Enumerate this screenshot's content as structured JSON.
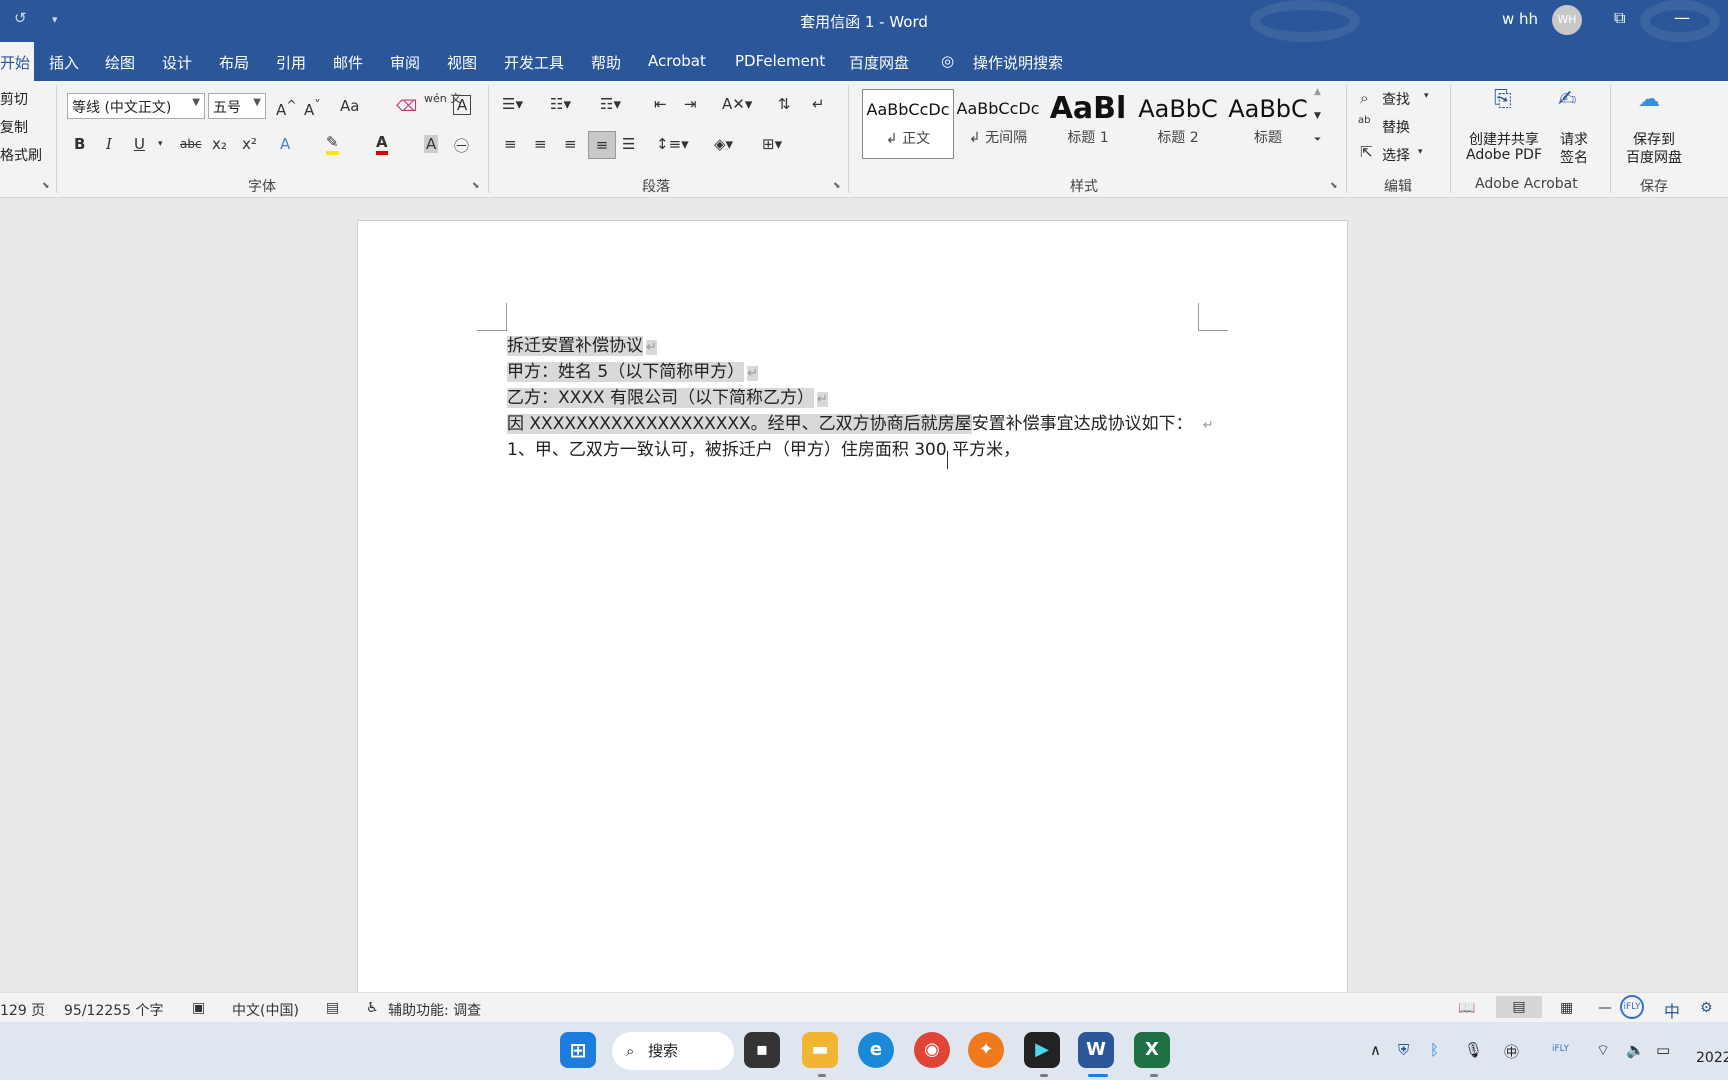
{
  "window": {
    "title": "套用信函 1  -  Word",
    "user_name": "w hh",
    "user_initials": "WH",
    "accent_color": "#2b579a"
  },
  "menu": {
    "tabs": [
      "开始",
      "插入",
      "绘图",
      "设计",
      "布局",
      "引用",
      "邮件",
      "审阅",
      "视图",
      "开发工具",
      "帮助",
      "Acrobat",
      "PDFelement",
      "百度网盘"
    ],
    "active_tab": "开始",
    "tell_me": "操作说明搜索"
  },
  "ribbon": {
    "clipboard": {
      "cut": "剪切",
      "copy": "复制",
      "format_painter": "格式刷"
    },
    "font": {
      "font_name": "等线 (中文正文)",
      "font_size": "五号",
      "group_label": "字体",
      "bold": "B",
      "italic": "I",
      "underline": "U",
      "strike": "abc",
      "sub": "x₂",
      "sup": "x²",
      "grow": "A^",
      "shrink": "A˅",
      "case": "Aa",
      "pinyin": "wén 文",
      "char_border": "A"
    },
    "paragraph": {
      "group_label": "段落"
    },
    "styles": {
      "group_label": "样式",
      "items": [
        {
          "sample": "AaBbCcDc",
          "name": "↲ 正文"
        },
        {
          "sample": "AaBbCcDc",
          "name": "↲ 无间隔"
        },
        {
          "sample": "AaBl",
          "name": "标题 1"
        },
        {
          "sample": "AaBbC",
          "name": "标题 2"
        },
        {
          "sample": "AaBbC",
          "name": "标题"
        }
      ]
    },
    "editing": {
      "find": "查找",
      "replace": "替换",
      "select": "选择",
      "group_label": "编辑"
    },
    "acrobat": {
      "create_share_line1": "创建并共享",
      "create_share_line2": "Adobe PDF",
      "request_sign_line1": "请求",
      "request_sign_line2": "签名",
      "group_label": "Adobe Acrobat"
    },
    "baidu": {
      "save_line1": "保存到",
      "save_line2": "百度网盘",
      "group_label": "保存"
    }
  },
  "document": {
    "lines": [
      {
        "text": "拆迁安置补偿协议",
        "highlight": true,
        "mark": "↵"
      },
      {
        "text": "甲方：姓名 5（以下简称甲方）",
        "highlight": true,
        "mark": "↵"
      },
      {
        "text": "乙方：XXXX 有限公司（以下简称乙方）",
        "highlight": true,
        "mark": "↵"
      },
      {
        "text_highlighted": "因 XXXXXXXXXXXXXXXXXXX。经甲、乙双方协商后就房屋",
        "text_rest": "安置补偿事宜达成协议如下：",
        "mark": "↵"
      },
      {
        "text": "1、甲、乙双方一致认可，被拆迁户（甲方）住房面积 300 平方米，",
        "highlight": false,
        "mark": ""
      }
    ]
  },
  "status": {
    "page": "129 页",
    "words": "95/12255 个字",
    "language": "中文(中国)",
    "accessibility": "辅助功能: 调查",
    "ime_mode": "中"
  },
  "taskbar": {
    "search": "搜索",
    "clock_year": "2022"
  }
}
